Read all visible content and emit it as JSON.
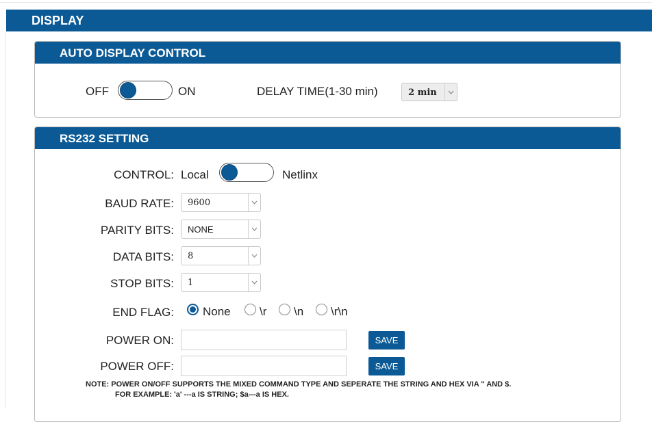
{
  "section": {
    "title": "DISPLAY"
  },
  "auto_display": {
    "title": "AUTO DISPLAY CONTROL",
    "off_label": "OFF",
    "on_label": "ON",
    "delay_label": "DELAY TIME(1-30 min)",
    "delay_value": "2 min"
  },
  "rs232": {
    "title": "RS232 SETTING",
    "control_label": "CONTROL:",
    "control_left": "Local",
    "control_right": "Netlinx",
    "baud_label": "BAUD RATE:",
    "baud_value": "9600",
    "parity_label": "PARITY BITS:",
    "parity_value": "NONE",
    "data_label": "DATA BITS:",
    "data_value": "8",
    "stop_label": "STOP BITS:",
    "stop_value": "1",
    "end_flag_label": "END FLAG:",
    "end_flag_options": [
      "None",
      "\\r",
      "\\n",
      "\\r\\n"
    ],
    "end_flag_selected": "None",
    "power_on_label": "POWER ON:",
    "power_on_value": "",
    "power_off_label": "POWER OFF:",
    "power_off_value": "",
    "save_label": "SAVE",
    "note_line1": "NOTE: POWER ON/OFF SUPPORTS THE MIXED COMMAND TYPE AND SEPERATE THE STRING AND HEX VIA '' AND $.",
    "note_line2": "FOR EXAMPLE: 'a' ---a IS STRING; $a---a IS HEX."
  },
  "colors": {
    "header_blue": "#0b5a96",
    "border": "#b9b9b9"
  },
  "icons": [
    "chevron-down-icon"
  ]
}
